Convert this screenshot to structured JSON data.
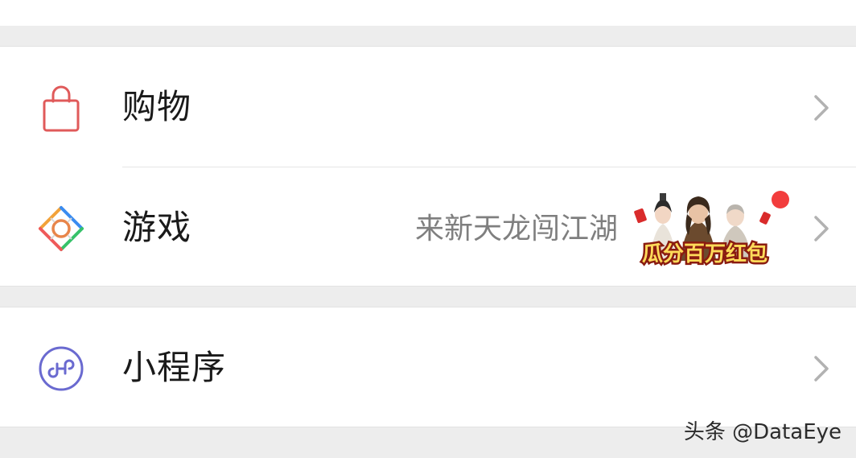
{
  "menu": {
    "shopping": {
      "label": "购物",
      "icon": "shopping-bag-icon"
    },
    "games": {
      "label": "游戏",
      "icon": "games-icon",
      "subtitle": "来新天龙闯江湖",
      "promo_text": "瓜分百万红包",
      "has_notification_dot": true
    },
    "mini_programs": {
      "label": "小程序",
      "icon": "mini-program-icon"
    }
  },
  "watermark": "头条 @DataEye",
  "colors": {
    "background": "#ededed",
    "card": "#ffffff",
    "text": "#1a1a1a",
    "subtitle": "#7f7f7f",
    "chevron": "#b2b2b2",
    "shopping_icon": "#e05a5a",
    "mini_program_icon": "#6a6ad0",
    "notification_dot": "#f23d3d"
  }
}
